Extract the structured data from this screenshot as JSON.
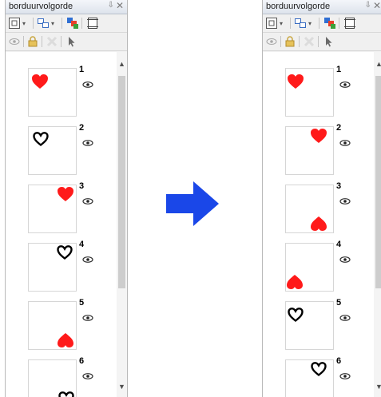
{
  "colors": {
    "heart_red": "#ff1a1a",
    "arrow_blue": "#1a47e8",
    "outline": "#000000"
  },
  "panels": [
    {
      "title": "borduurvolgorde",
      "pin_glyph": "⇩",
      "close_glyph": "✕",
      "items": [
        {
          "number": "1",
          "shape": "filled-heart"
        },
        {
          "number": "2",
          "shape": "outline-heart"
        },
        {
          "number": "3",
          "shape": "filled-heart"
        },
        {
          "number": "4",
          "shape": "outline-heart"
        },
        {
          "number": "5",
          "shape": "filled-heart"
        },
        {
          "number": "6",
          "shape": "outline-heart"
        }
      ]
    },
    {
      "title": "borduurvolgorde",
      "pin_glyph": "⇩",
      "close_glyph": "✕",
      "items": [
        {
          "number": "1",
          "shape": "filled-heart"
        },
        {
          "number": "2",
          "shape": "filled-heart"
        },
        {
          "number": "3",
          "shape": "filled-heart"
        },
        {
          "number": "4",
          "shape": "filled-heart"
        },
        {
          "number": "5",
          "shape": "outline-heart"
        },
        {
          "number": "6",
          "shape": "outline-heart"
        }
      ]
    }
  ],
  "arrow_icon": "right-arrow-icon"
}
